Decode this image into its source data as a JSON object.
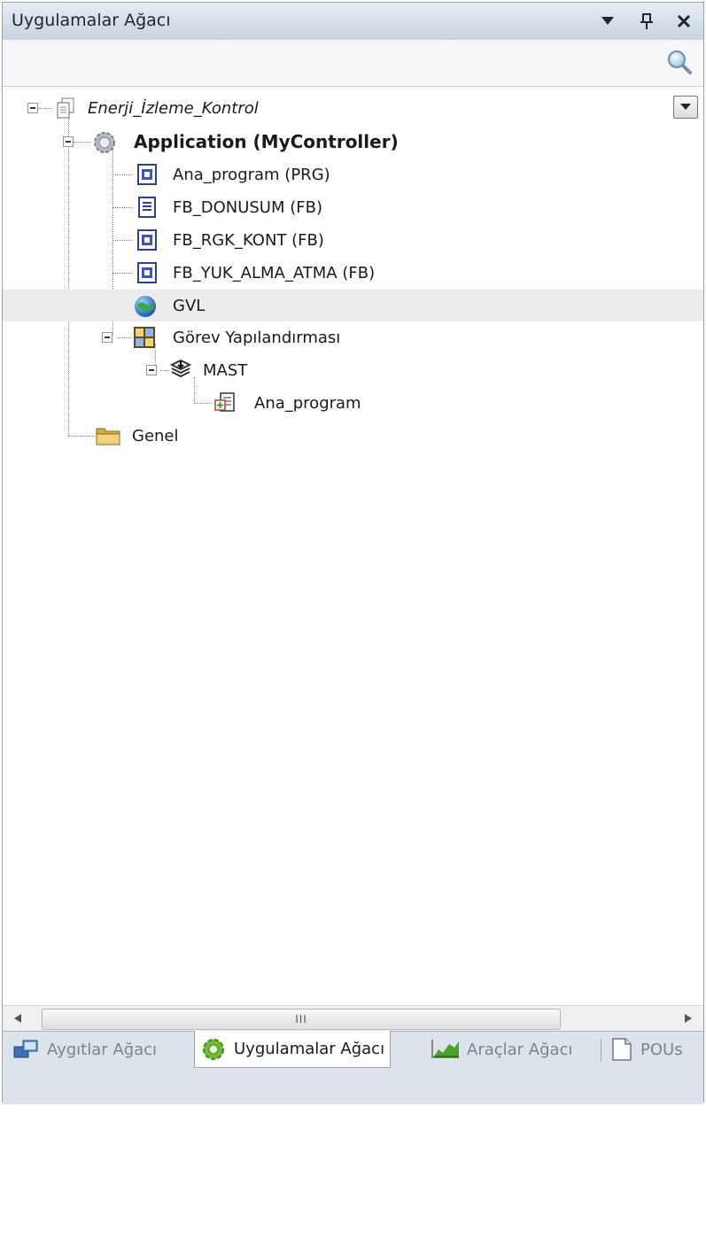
{
  "window": {
    "title": "Uygulamalar Ağacı"
  },
  "search": {
    "placeholder": "",
    "value": ""
  },
  "tree": {
    "root": "Enerji_İzleme_Kontrol",
    "application": "Application (MyController)",
    "pous": [
      {
        "label": "Ana_program (PRG)",
        "icon": "program-icon"
      },
      {
        "label": "FB_DONUSUM (FB)",
        "icon": "text-document-icon"
      },
      {
        "label": "FB_RGK_KONT (FB)",
        "icon": "function-block-icon"
      },
      {
        "label": "FB_YUK_ALMA_ATMA (FB)",
        "icon": "function-block-icon"
      }
    ],
    "gvl": "GVL",
    "task_config": "Görev Yapılandırması",
    "task": "MAST",
    "task_program": "Ana_program",
    "general": "Genel"
  },
  "scrollbar": {
    "thumb_grip": "III"
  },
  "tabs": [
    {
      "label": "Aygıtlar Ağacı",
      "icon": "devices-icon",
      "active": false
    },
    {
      "label": "Uygulamalar Ağacı",
      "icon": "applications-gear-icon",
      "active": true
    },
    {
      "label": "Araçlar Ağacı",
      "icon": "tools-chart-icon",
      "active": false
    },
    {
      "label": "POUs",
      "icon": "pou-document-icon",
      "active": false
    }
  ],
  "colors": {
    "titlebar": "#c9d3df",
    "selected_row": "#ececec",
    "folder": "#e9c46a",
    "globe": "#2a7fd4",
    "active_tab_icon": "#5aa02c"
  }
}
